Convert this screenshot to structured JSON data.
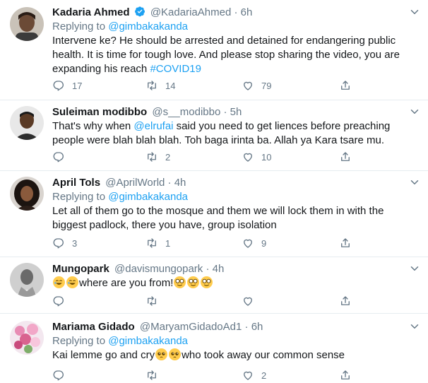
{
  "tweets": [
    {
      "name": "Kadaria Ahmed",
      "handle": "@KadariaAhmed",
      "time": "6h",
      "verified": true,
      "replying_prefix": "Replying to ",
      "replying_to": "@gimbakakanda",
      "text_main": "Intervene ke? He should be arrested and detained for endangering public health. It is time for tough love. And please stop sharing the video, you are expanding his reach ",
      "hashtag": "#COVID19",
      "replies": "17",
      "retweets": "14",
      "likes": "79"
    },
    {
      "name": "Suleiman modibbo",
      "handle": "@s__modibbo",
      "time": "5h",
      "text_before": "That's why when ",
      "mention": "@elrufai",
      "text_after": " said you need to get liences before preaching people were blah blah blah. Toh baga irinta ba. Allah ya Kara tsare mu.",
      "replies": "",
      "retweets": "2",
      "likes": "10"
    },
    {
      "name": "April Tols",
      "handle": "@AprilWorld",
      "time": "4h",
      "replying_prefix": "Replying to ",
      "replying_to": "@gimbakakanda",
      "text": "Let all of them go to the mosque and them we will lock them in with the biggest padlock, there you have, group isolation",
      "replies": "3",
      "retweets": "1",
      "likes": "9"
    },
    {
      "name": "Mungopark",
      "handle": "@davismungopark",
      "time": "4h",
      "text": "where are you from!",
      "emoji_before": [
        "rofl-emoji",
        "rofl-emoji"
      ],
      "emoji_after": [
        "nerd-emoji",
        "nerd-emoji",
        "nerd-emoji"
      ],
      "replies": "",
      "retweets": "",
      "likes": ""
    },
    {
      "name": "Mariama Gidado",
      "handle": "@MaryamGidadoAd1",
      "time": "6h",
      "replying_prefix": "Replying to ",
      "replying_to": "@gimbakakanda",
      "text_before": "Kai lemme go and cry",
      "text_after": "who took away our common sense",
      "emoji": [
        "pleading-emoji",
        "pleading-emoji"
      ],
      "replies": "",
      "retweets": "",
      "likes": "2"
    }
  ],
  "separator": "·",
  "colors": {
    "link": "#1da1f2",
    "muted": "#657786",
    "text": "#14171a",
    "border": "#e6ecf0"
  },
  "icons": [
    "reply-icon",
    "retweet-icon",
    "like-icon",
    "share-icon",
    "caret-down-icon",
    "verified-icon"
  ]
}
